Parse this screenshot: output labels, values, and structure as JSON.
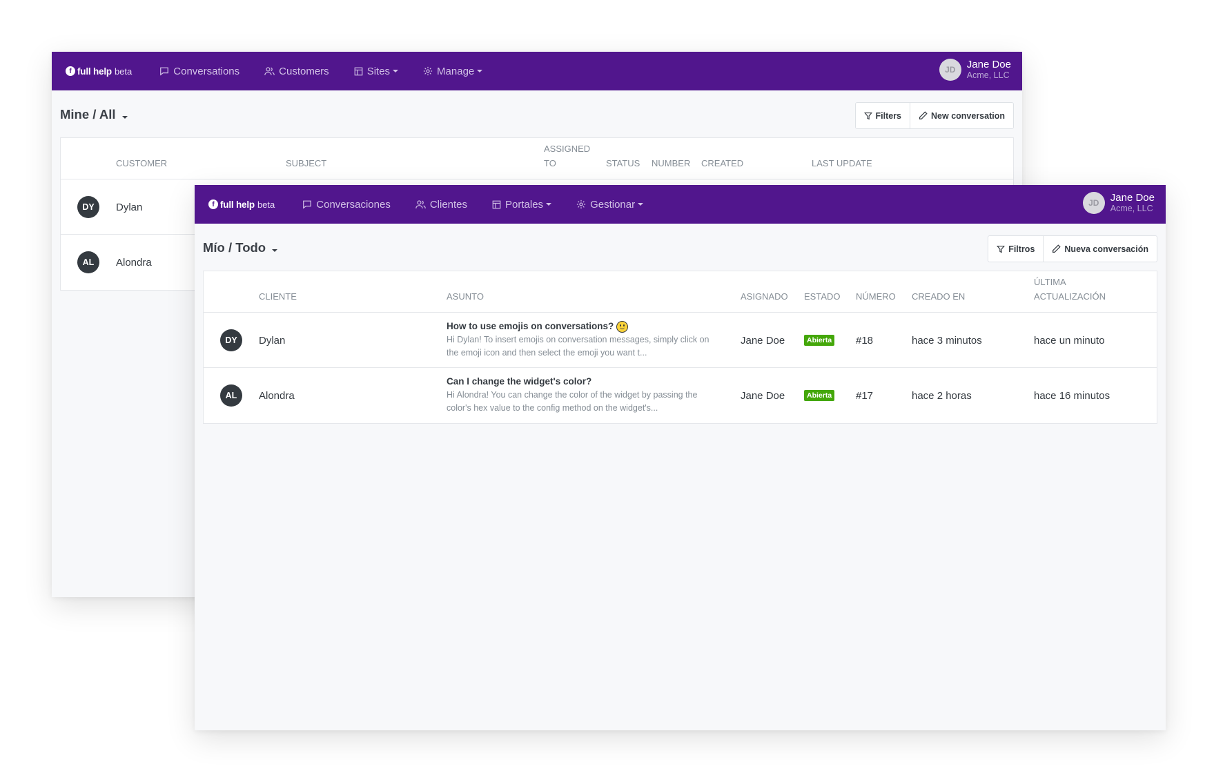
{
  "back_window": {
    "brand": {
      "logo": "f",
      "name": "full help",
      "tag": "beta"
    },
    "nav": [
      {
        "label": "Conversations",
        "icon": "chat-icon"
      },
      {
        "label": "Customers",
        "icon": "users-icon"
      },
      {
        "label": "Sites",
        "icon": "layout-icon",
        "dropdown": true
      },
      {
        "label": "Manage",
        "icon": "gear-icon",
        "dropdown": true
      }
    ],
    "user": {
      "initials": "JD",
      "name": "Jane Doe",
      "org": "Acme, LLC"
    },
    "scope": "Mine / All",
    "buttons": {
      "filters": "Filters",
      "new": "New conversation"
    },
    "columns": {
      "customer": "CUSTOMER",
      "subject": "SUBJECT",
      "assigned_1": "ASSIGNED",
      "assigned_2": "TO",
      "status": "STATUS",
      "number": "NUMBER",
      "created": "CREATED",
      "last_update": "LAST UPDATE"
    },
    "rows": [
      {
        "initials": "DY",
        "name": "Dylan"
      },
      {
        "initials": "AL",
        "name": "Alondra"
      }
    ]
  },
  "front_window": {
    "brand": {
      "logo": "f",
      "name": "full help",
      "tag": "beta"
    },
    "nav": [
      {
        "label": "Conversaciones",
        "icon": "chat-icon"
      },
      {
        "label": "Clientes",
        "icon": "users-icon"
      },
      {
        "label": "Portales",
        "icon": "layout-icon",
        "dropdown": true
      },
      {
        "label": "Gestionar",
        "icon": "gear-icon",
        "dropdown": true
      }
    ],
    "user": {
      "initials": "JD",
      "name": "Jane Doe",
      "org": "Acme, LLC"
    },
    "scope": "Mío / Todo",
    "buttons": {
      "filters": "Filtros",
      "new": "Nueva conversación"
    },
    "columns": {
      "customer": "CLIENTE",
      "subject": "ASUNTO",
      "assigned": "ASIGNADO",
      "status": "ESTADO",
      "number": "NÚMERO",
      "created": "CREADO EN",
      "last_update_1": "ÚLTIMA",
      "last_update_2": "ACTUALIZACIÓN"
    },
    "rows": [
      {
        "initials": "DY",
        "name": "Dylan",
        "subject": "How to use emojis on conversations?",
        "preview_1": "Hi Dylan! To insert emojis on conversation messages, simply click on",
        "preview_2": "the emoji icon and then select the emoji you want t...",
        "assignee": "Jane Doe",
        "status": "Abierta",
        "number": "#18",
        "created": "hace 3 minutos",
        "updated": "hace un minuto"
      },
      {
        "initials": "AL",
        "name": "Alondra",
        "subject": "Can I change the widget's color?",
        "preview_1": "Hi Alondra! You can change the color of the widget by passing the",
        "preview_2": "color's hex value to the config method on the widget's...",
        "assignee": "Jane Doe",
        "status": "Abierta",
        "number": "#17",
        "created": "hace 2 horas",
        "updated": "hace 16 minutos"
      }
    ]
  },
  "colors": {
    "navbar": "#51168d",
    "badge": "#44a70a",
    "avatar": "#343a40"
  }
}
